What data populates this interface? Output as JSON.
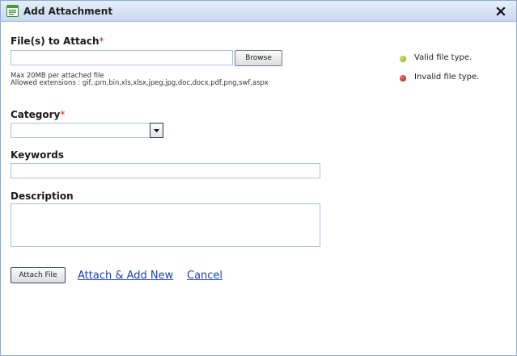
{
  "window": {
    "title": "Add Attachment",
    "icon": "form-window-icon",
    "close_icon": "close-icon"
  },
  "files": {
    "label": "File(s) to Attach",
    "required_mark": "*",
    "input_value": "",
    "browse_label": "Browse",
    "hint_size": "Max 20MB per attached file",
    "hint_extensions": "Allowed extensions : gif,.prn,bin,xls,xlsx,jpeg,jpg,doc,docx,pdf,png,swf,aspx"
  },
  "legend": {
    "valid": {
      "text": "Valid file type.",
      "color": "#8bb52a"
    },
    "invalid": {
      "text": "Invalid file type.",
      "color": "#c32020"
    }
  },
  "category": {
    "label": "Category",
    "required_mark": "*",
    "selected_value": ""
  },
  "keywords": {
    "label": "Keywords",
    "value": ""
  },
  "description": {
    "label": "Description",
    "value": ""
  },
  "actions": {
    "attach_file": "Attach File",
    "attach_add_new": "Attach & Add New",
    "cancel": "Cancel"
  }
}
